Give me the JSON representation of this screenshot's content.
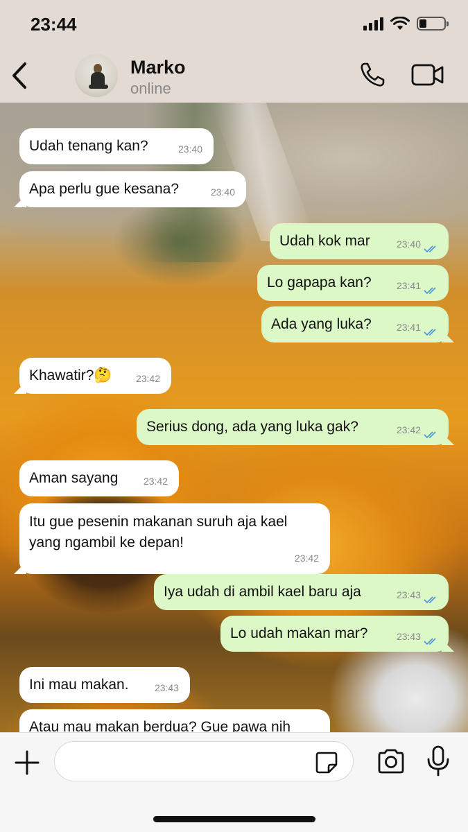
{
  "status_bar": {
    "time": "23:44",
    "battery_level": 0.3
  },
  "header": {
    "contact_name": "Marko",
    "contact_status": "online",
    "icons": [
      "back-chevron-icon",
      "phone-icon",
      "video-camera-icon"
    ]
  },
  "messages": [
    {
      "side": "in",
      "text": "Udah tenang kan?",
      "time": "23:40"
    },
    {
      "side": "in",
      "text": "Apa perlu gue kesana?",
      "time": "23:40"
    },
    {
      "side": "out",
      "text": "Udah kok mar",
      "time": "23:40",
      "read": true
    },
    {
      "side": "out",
      "text": "Lo gapapa kan?",
      "time": "23:41",
      "read": true
    },
    {
      "side": "out",
      "text": "Ada yang luka?",
      "time": "23:41",
      "read": true
    },
    {
      "side": "in",
      "text": "Khawatir?🤔",
      "time": "23:42"
    },
    {
      "side": "out",
      "text": "Serius dong, ada yang luka gak?",
      "time": "23:42",
      "read": true
    },
    {
      "side": "in",
      "text": "Aman sayang",
      "time": "23:42"
    },
    {
      "side": "in",
      "text": "Itu gue pesenin makanan suruh aja kael yang ngambil ke depan!",
      "time": "23:42"
    },
    {
      "side": "out",
      "text": "Iya udah di ambil kael baru aja",
      "time": "23:43",
      "read": true
    },
    {
      "side": "out",
      "text": "Lo udah makan mar?",
      "time": "23:43",
      "read": true
    },
    {
      "side": "in",
      "text": "Ini mau makan.",
      "time": "23:43"
    },
    {
      "side": "in",
      "text": "Atau mau makan berdua? Gue pawa nih",
      "time": ""
    }
  ],
  "composer": {
    "message_value": "",
    "icons": [
      "plus-icon",
      "sticker-icon",
      "camera-icon",
      "microphone-icon"
    ]
  },
  "colors": {
    "header_bg": "#e3dad3",
    "incoming_bubble": "#ffffff",
    "outgoing_bubble": "#dbf8c6",
    "read_tick": "#4a90e2"
  }
}
